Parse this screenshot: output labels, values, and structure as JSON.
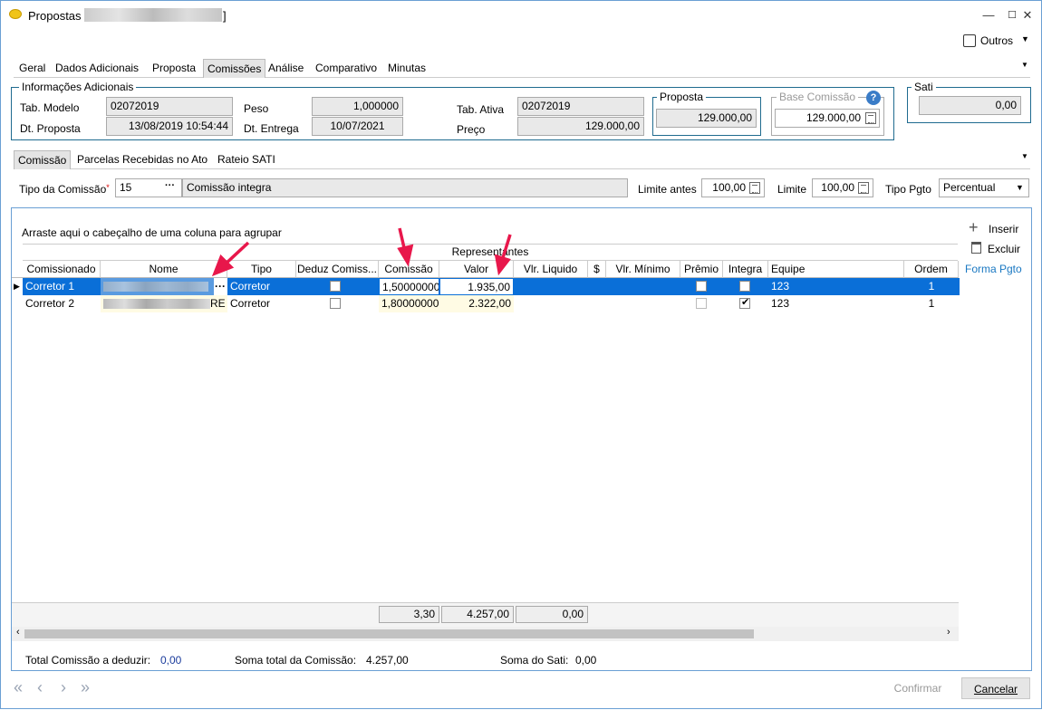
{
  "window": {
    "title": "Propostas",
    "title_suffix": "]",
    "min": "—",
    "max": "☐",
    "close": "✕"
  },
  "toolbar": {
    "outros": "Outros"
  },
  "tabs": [
    "Geral",
    "Dados Adicionais",
    "Proposta",
    "Comissões",
    "Análise",
    "Comparativo",
    "Minutas"
  ],
  "info": {
    "legend": "Informações Adicionais",
    "tab_modelo_label": "Tab. Modelo",
    "tab_modelo": "02072019",
    "dt_proposta_label": "Dt. Proposta",
    "dt_proposta": "13/08/2019 10:54:44",
    "peso_label": "Peso",
    "peso": "1,000000",
    "dt_entrega_label": "Dt. Entrega",
    "dt_entrega": "10/07/2021",
    "tab_ativa_label": "Tab. Ativa",
    "tab_ativa": "02072019",
    "preco_label": "Preço",
    "preco": "129.000,00",
    "proposta_legend": "Proposta",
    "proposta": "129.000,00",
    "base_legend": "Base Comissão",
    "base": "129.000,00",
    "sati_legend": "Sati",
    "sati": "0,00"
  },
  "subtabs": [
    "Comissão",
    "Parcelas Recebidas no Ato",
    "Rateio SATI"
  ],
  "comissao": {
    "tipo_label": "Tipo da Comissão",
    "tipo_code": "15",
    "tipo_desc": "Comissão integra",
    "limite_antes_label": "Limite antes",
    "limite_antes": "100,00",
    "limite_label": "Limite",
    "limite": "100,00",
    "tipo_pgto_label": "Tipo Pgto",
    "tipo_pgto": "Percentual"
  },
  "grid": {
    "group_hint": "Arraste aqui o cabeçalho de uma coluna para agrupar",
    "band": "Representantes",
    "columns": [
      "Comissionado",
      "Nome",
      "Tipo",
      "Deduz Comiss...",
      "Comissão",
      "Valor",
      "Vlr. Liquido",
      "$",
      "Vlr. Mínimo",
      "Prêmio",
      "Integra",
      "Equipe",
      "Ordem"
    ],
    "rows": [
      {
        "comissionado": "Corretor 1",
        "nome_more": "···",
        "tipo": "Corretor",
        "deduz": false,
        "comissao": "1,50000000",
        "valor": "1.935,00",
        "premio": true,
        "integra": true,
        "equipe": "123",
        "ordem": "1"
      },
      {
        "comissionado": "Corretor 2",
        "nome_tail": "RE",
        "tipo": "Corretor",
        "deduz": false,
        "comissao": "1,80000000",
        "valor": "2.322,00",
        "premio": false,
        "integra": true,
        "equipe": "123",
        "ordem": "1"
      }
    ],
    "footer": {
      "comissao": "3,30",
      "valor": "4.257,00",
      "liquido": "0,00"
    }
  },
  "side": {
    "inserir": "Inserir",
    "excluir": "Excluir",
    "forma": "Forma Pgto"
  },
  "totals": {
    "deduzir_label": "Total Comissão a deduzir:",
    "deduzir": "0,00",
    "soma_label": "Soma total da Comissão:",
    "soma": "4.257,00",
    "sati_label": "Soma do Sati:",
    "sati": "0,00"
  },
  "buttons": {
    "confirmar": "Confirmar",
    "cancelar": "Cancelar"
  },
  "colors": {
    "selection": "#0a6fd8",
    "accent": "#1f6b8f",
    "arrow": "#e8174b"
  }
}
